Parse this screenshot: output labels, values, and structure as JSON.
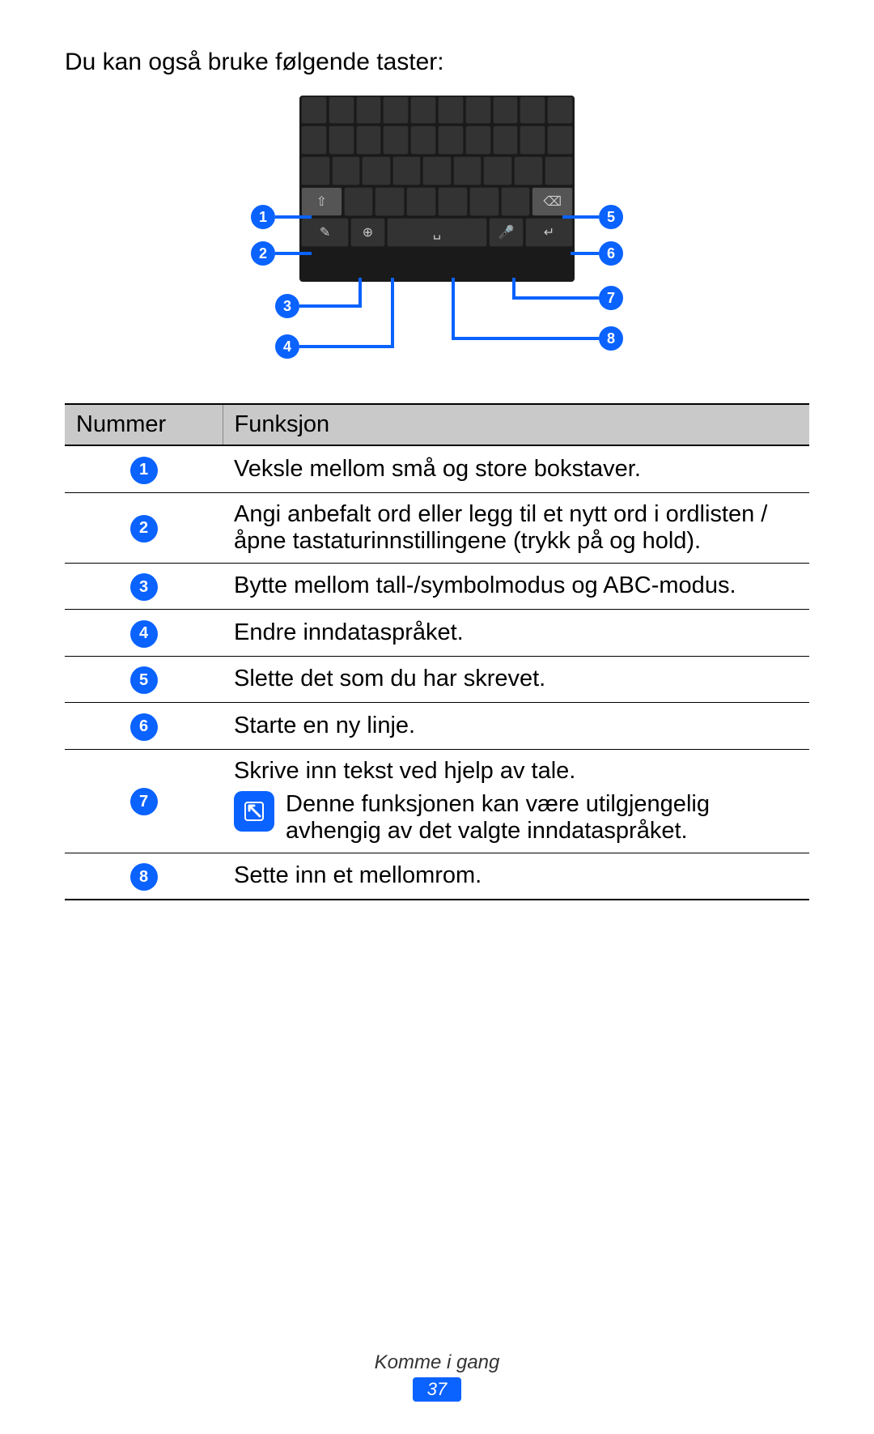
{
  "intro": "Du kan også bruke følgende taster:",
  "table": {
    "headers": {
      "num": "Nummer",
      "func": "Funksjon"
    },
    "rows": [
      {
        "n": "1",
        "f": "Veksle mellom små og store bokstaver."
      },
      {
        "n": "2",
        "f": "Angi anbefalt ord eller legg til et nytt ord i ordlisten / åpne tastaturinnstillingene (trykk på og hold)."
      },
      {
        "n": "3",
        "f": "Bytte mellom tall-/symbolmodus og ABC-modus."
      },
      {
        "n": "4",
        "f": "Endre inndataspråket."
      },
      {
        "n": "5",
        "f": "Slette det som du har skrevet."
      },
      {
        "n": "6",
        "f": "Starte en ny linje."
      },
      {
        "n": "7",
        "f": "Skrive inn tekst ved hjelp av tale.",
        "note": "Denne funksjonen kan være utilgjengelig avhengig av det valgte inndataspråket."
      },
      {
        "n": "8",
        "f": "Sette inn et mellomrom."
      }
    ]
  },
  "callouts": {
    "c1": "1",
    "c2": "2",
    "c3": "3",
    "c4": "4",
    "c5": "5",
    "c6": "6",
    "c7": "7",
    "c8": "8"
  },
  "footer": {
    "section": "Komme i gang",
    "page": "37"
  },
  "colors": {
    "accent": "#0a62ff"
  }
}
